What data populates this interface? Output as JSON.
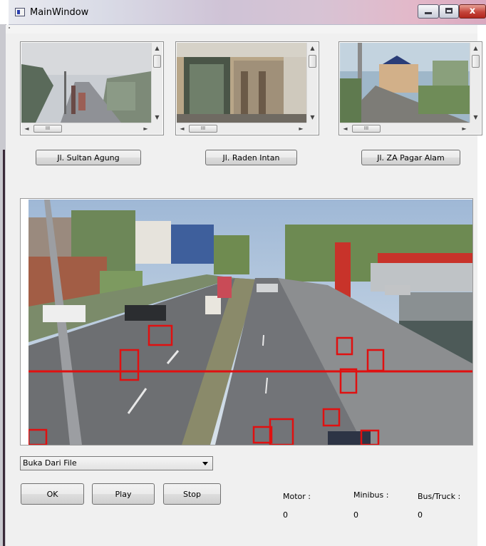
{
  "window": {
    "title": "MainWindow",
    "close_glyph": "x",
    "icon": "app-window-icon"
  },
  "cameras": [
    {
      "label": "Jl. Sultan Agung"
    },
    {
      "label": "Jl. Raden Intan"
    },
    {
      "label": "Jl. ZA Pagar Alam"
    }
  ],
  "scroll": {
    "knob_glyph": "III",
    "up": "▲",
    "down": "▼",
    "left": "◄",
    "right": "►"
  },
  "source_select": {
    "selected": "Buka Dari File"
  },
  "buttons": {
    "ok": "OK",
    "play": "Play",
    "stop": "Stop"
  },
  "counters": [
    {
      "label": "Motor :",
      "value": "0"
    },
    {
      "label": "Minibus :",
      "value": "0"
    },
    {
      "label": "Bus/Truck :",
      "value": "0"
    }
  ],
  "colors": {
    "detection_box": "#e01010",
    "count_line": "#e01010"
  }
}
